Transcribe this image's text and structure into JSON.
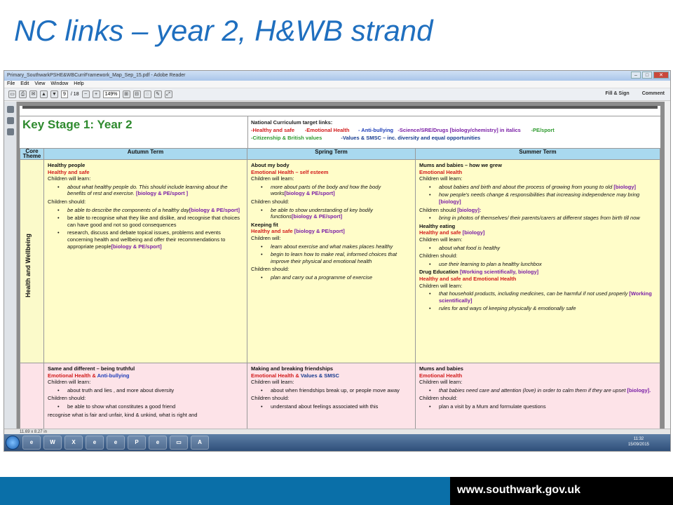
{
  "slide": {
    "title": "NC links – year 2, H&WB strand",
    "footer_url": "www.southwark.gov.uk"
  },
  "app": {
    "window_title": "Primary_SouthwarkPSHE&WBCurriFramework_Map_Sep_15.pdf - Adobe Reader",
    "menu": [
      "File",
      "Edit",
      "View",
      "Window",
      "Help"
    ],
    "page_current": "9",
    "page_total": "/ 18",
    "zoom": "149%",
    "fill_sign": "Fill & Sign",
    "comment": "Comment",
    "status_size": "11.69 x 8.27 in",
    "clock_time": "11:32",
    "clock_date": "15/09/2015"
  },
  "doc": {
    "ks_title": "Key Stage 1: Year 2",
    "nc_label": "National Curriculum target links:",
    "nc_l1_a": "-Healthy and safe",
    "nc_l1_b": "-Emotional Health",
    "nc_l1_c": "- Anti-bullying",
    "nc_l1_d": "-Science/SRE/Drugs [biology/chemistry] in italics",
    "nc_l1_e": "-PE/sport",
    "nc_l2_a": "-Citizenship & British values",
    "nc_l2_b": "-Values & SMSC – inc. diversity and equal opportunities",
    "headers": {
      "core": "Core Theme",
      "autumn": "Autumn Term",
      "spring": "Spring Term",
      "summer": "Summer Term"
    },
    "row1_label": "Health and Wellbeing",
    "a1": {
      "title": "Healthy people",
      "sub": "Healthy and safe",
      "learn": "Children will learn:",
      "b1": "about what healthy people do. This should include learning about the benefits of rest and exercise.",
      "b1_tag": "[biology & PE/sport ]",
      "should": "Children should:",
      "b2": "be able to describe the components of a healthy day",
      "b2_tag": "[biology & PE/sport]",
      "b3": "be able to recognise what they like and dislike, and recognise that choices can have good and not so good consequences",
      "b4": "research, discuss and debate topical issues, problems and events concerning health and wellbeing and offer their recommendations to appropriate people",
      "b4_tag": "[biology & PE/sport]"
    },
    "s1": {
      "title": "About my body",
      "sub": "Emotional Health – self esteem",
      "learn": "Children will learn:",
      "b1": "more about parts of the body and how the body works",
      "b1_tag": "[biology & PE/sport]",
      "should": "Children should:",
      "b2": "be able to show understanding of key bodily functions",
      "b2_tag": "[biology & PE/sport]",
      "keep": "Keeping fit",
      "keep_sub": "Healthy and safe",
      "keep_tag": "[biology & PE/sport]",
      "will": "Children will:",
      "b3": "learn about exercise and what makes places healthy",
      "b4": "begin to learn how to make real, informed choices that improve their physical and emotional health",
      "should2": "Children should:",
      "b5": "plan and carry out a programme of exercise"
    },
    "u1": {
      "title": "Mums and babies – how we grew",
      "sub": "Emotional Health",
      "learn": "Children will learn:",
      "b1": "about babies and birth and about the process of growing from young to old",
      "b1_tag": "[biology]",
      "b2": "how people's needs change & responsibilities that increasing independence may bring",
      "b2_tag": "[biology]",
      "should": "Children should",
      "should_tag": "[biology]:",
      "b3": "bring in photos of themselves/ their parents/carers at different stages from birth till now",
      "he": "Healthy eating",
      "he_sub": "Healthy and safe",
      "he_tag": "[biology]",
      "learn2": "Children will learn:",
      "b4": "about what food is healthy",
      "should2": "Children should:",
      "b5": "use their learning to plan a healthy lunchbox",
      "de": "Drug Education",
      "de_tag": "[Working scientifically, biology]",
      "de_sub": "Healthy and safe and Emotional Health",
      "learn3": "Children will learn:",
      "b6": "that household products, including medicines, can be harmful if not used properly",
      "b6_tag": "[Working scientifically]",
      "b7": "rules for and ways of keeping physically & emotionally safe"
    },
    "a2": {
      "title": "Same and different – being truthful",
      "sub_a": "Emotional Health &",
      "sub_b": "Anti-bullying",
      "learn": "Children will learn:",
      "b1": "about truth and lies , and more about diversity",
      "should": "Children should:",
      "b2": "be able to show what constitutes a good friend",
      "b3": "recognise what is fair and unfair, kind & unkind, what is right and"
    },
    "s2": {
      "title": "Making and breaking friendships",
      "sub_a": "Emotional Health &",
      "sub_b": "Values & SMSC",
      "learn": "Children will learn:",
      "b1": "about when friendships break up, or people move away",
      "should": "Children should:",
      "b2": "understand about feelings associated with this"
    },
    "u2": {
      "title": "Mums and babies",
      "sub": "Emotional Health",
      "learn": "Children will learn:",
      "b1": "that babies need care and attention (love) in order to calm them if they are upset",
      "b1_tag": "[biology].",
      "should": "Children should:",
      "b2": "plan a visit by a Mum and formulate questions"
    }
  },
  "taskbar_apps": [
    "ie-icon",
    "word-icon",
    "excel-icon",
    "ie-icon",
    "ie-icon",
    "powerpoint-icon",
    "ie-icon",
    "folder-icon",
    "acrobat-icon"
  ],
  "colors": {
    "title_blue": "#1f6fbf",
    "footer_blue": "#0a6fa8",
    "ks_green": "#2e8a2e",
    "header_blue": "#a9d9ef",
    "row_yellow": "#fffdc9",
    "row_pink": "#fde3e8"
  }
}
